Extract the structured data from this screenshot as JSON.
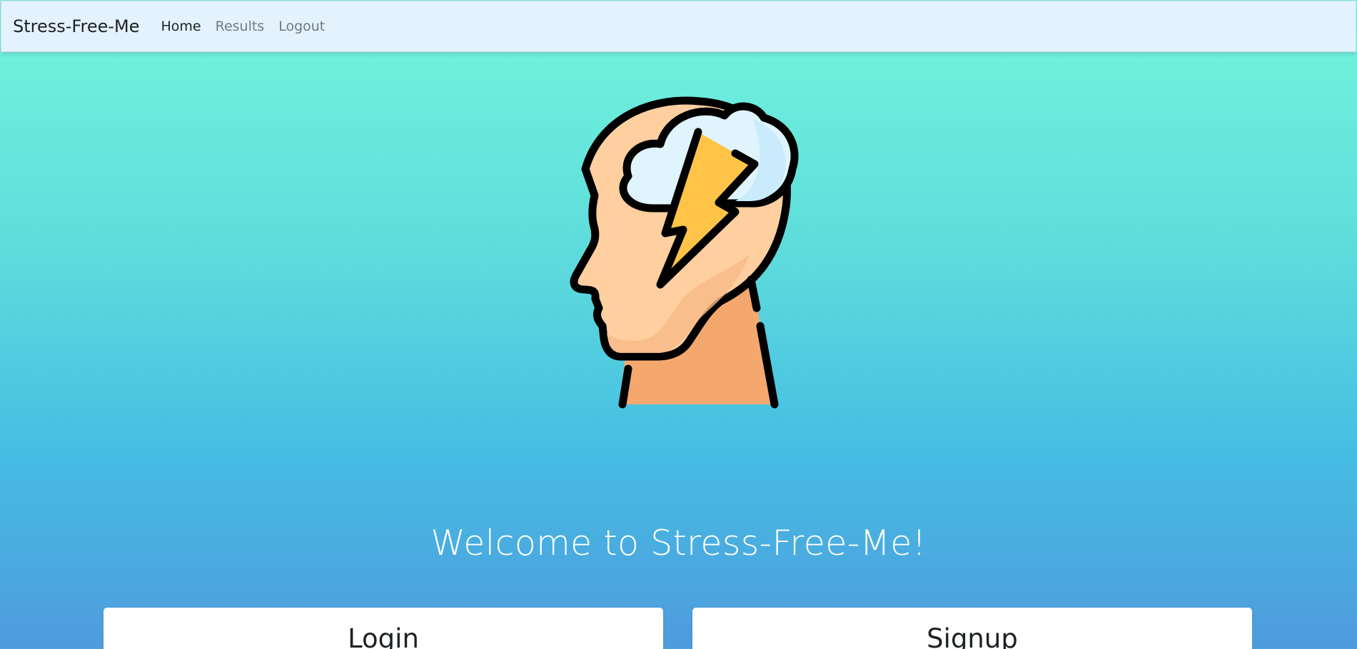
{
  "navbar": {
    "brand": "Stress-Free-Me",
    "links": [
      {
        "label": "Home",
        "active": true
      },
      {
        "label": "Results",
        "active": false
      },
      {
        "label": "Logout",
        "active": false
      }
    ]
  },
  "hero": {
    "illustration": "stressed-head-icon",
    "title": "Welcome to Stress-Free-Me!"
  },
  "cards": {
    "login_title": "Login",
    "signup_title": "Signup"
  },
  "colors": {
    "navbar_bg": "#e3f2fd",
    "gradient_top": "#74f5dc",
    "gradient_bottom": "#4f9bdd",
    "skin": "#ffcfa0",
    "neck": "#f5a86e",
    "cloud": "#dff4fc",
    "bolt": "#ffc447"
  }
}
